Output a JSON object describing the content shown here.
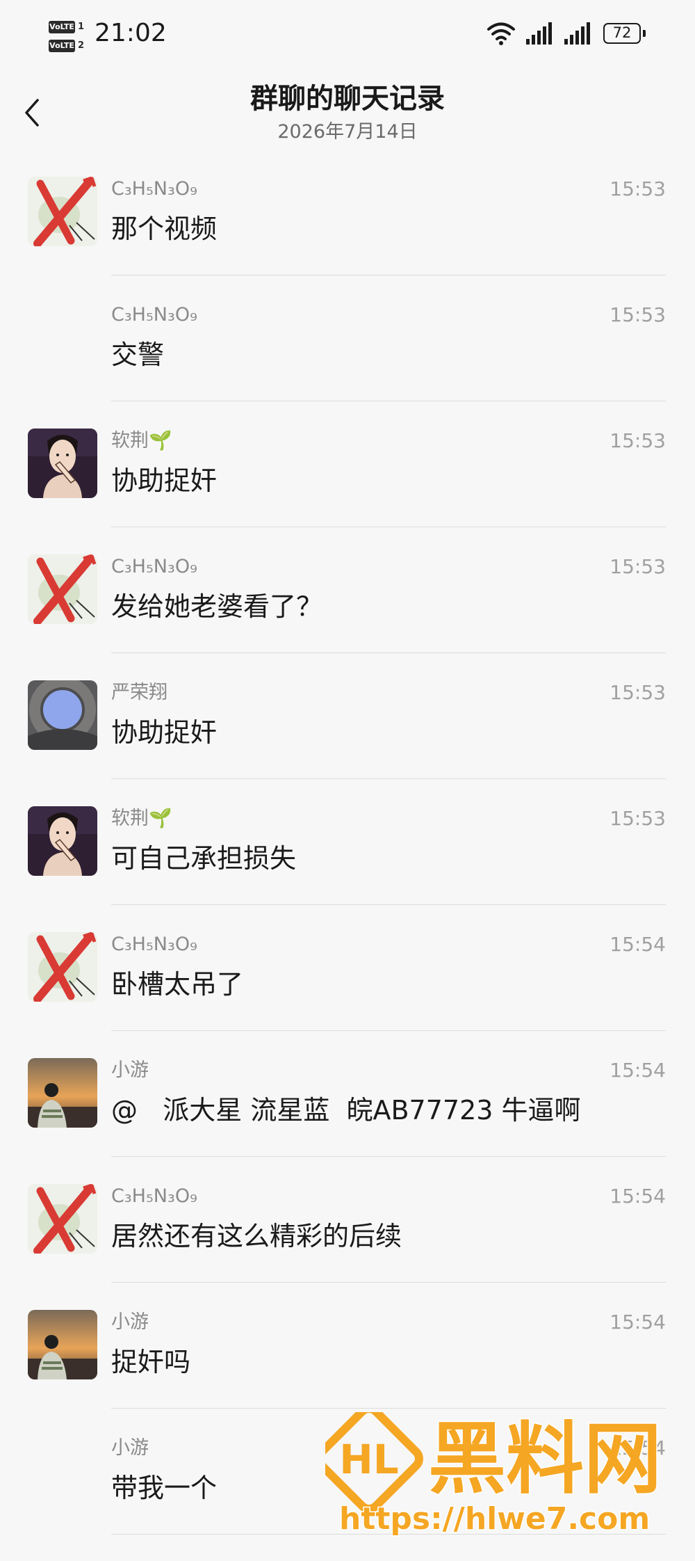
{
  "status_bar": {
    "volte_1": "VoLTE",
    "volte_1_num": "1",
    "volte_2": "VoLTE",
    "volte_2_num": "2",
    "time": "21:02",
    "battery": "72"
  },
  "header": {
    "title": "群聊的聊天记录",
    "date": "2026年7月14日"
  },
  "messages": [
    {
      "sender": "C₃H₅N₃O₉",
      "time": "15:53",
      "text": "那个视频",
      "avatar": "x-mark-avatar"
    },
    {
      "sender": "C₃H₅N₃O₉",
      "time": "15:53",
      "text": "交警",
      "avatar": "none"
    },
    {
      "sender": "软荆🌱",
      "time": "15:53",
      "text": "协助捉奸",
      "avatar": "man-smoking-avatar"
    },
    {
      "sender": "C₃H₅N₃O₉",
      "time": "15:53",
      "text": "发给她老婆看了？",
      "avatar": "x-mark-avatar"
    },
    {
      "sender": "严荣翔",
      "time": "15:53",
      "text": "协助捉奸",
      "avatar": "moon-gate-avatar"
    },
    {
      "sender": "软荆🌱",
      "time": "15:53",
      "text": "可自己承担损失",
      "avatar": "man-smoking-avatar"
    },
    {
      "sender": "C₃H₅N₃O₉",
      "time": "15:54",
      "text": "卧槽太吊了",
      "avatar": "x-mark-avatar"
    },
    {
      "sender": "小游",
      "time": "15:54",
      "text": "@   派大星 流星蓝  皖AB77723 牛逼啊",
      "avatar": "sunset-person-avatar"
    },
    {
      "sender": "C₃H₅N₃O₉",
      "time": "15:54",
      "text": "居然还有这么精彩的后续",
      "avatar": "x-mark-avatar"
    },
    {
      "sender": "小游",
      "time": "15:54",
      "text": "捉奸吗",
      "avatar": "sunset-person-avatar"
    },
    {
      "sender": "小游",
      "time": "15:54",
      "text": "带我一个",
      "avatar": "none"
    }
  ],
  "watermark": {
    "brand": "黑料网",
    "url": "https://hlwe7.com",
    "color": "#f5a623"
  }
}
